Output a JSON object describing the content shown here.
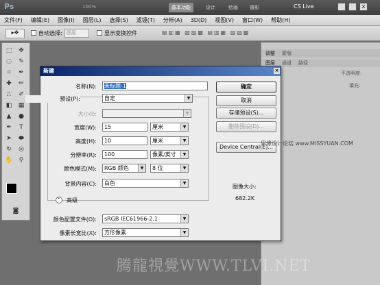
{
  "app": {
    "logo": "Ps",
    "zoom": "100%",
    "workspace": "基本功能",
    "ws_tabs": [
      "设计",
      "绘画",
      "摄影"
    ],
    "cslive": "CS Live"
  },
  "menu": [
    "文件(F)",
    "编辑(E)",
    "图像(I)",
    "图层(L)",
    "选择(S)",
    "滤镜(T)",
    "分析(A)",
    "3D(D)",
    "视图(V)",
    "窗口(W)",
    "帮助(H)"
  ],
  "options": {
    "auto_select": "自动选择:",
    "layer": "图层",
    "show_transform": "显示变换控件"
  },
  "panel": {
    "tabs1": [
      "调整",
      "蒙版"
    ],
    "tabs2": [
      "图层",
      "通道",
      "路径"
    ],
    "opacity": "不透明度:",
    "fill": "填充:"
  },
  "dialog": {
    "title": "新建",
    "name_label": "名称(N):",
    "name_value": "未标题-1",
    "preset_label": "预设(P):",
    "preset_value": "自定",
    "size_label": "大小(I):",
    "width_label": "宽度(W):",
    "width_value": "15",
    "width_unit": "厘米",
    "height_label": "高度(H):",
    "height_value": "10",
    "height_unit": "厘米",
    "res_label": "分辨率(R):",
    "res_value": "100",
    "res_unit": "像素/英寸",
    "mode_label": "颜色模式(M):",
    "mode_value": "RGB 颜色",
    "bits_value": "8 位",
    "bg_label": "背景内容(C):",
    "bg_value": "白色",
    "advanced": "高级",
    "profile_label": "颜色配置文件(O):",
    "profile_value": "sRGB IEC61966-2.1",
    "aspect_label": "像素长宽比(X):",
    "aspect_value": "方形像素",
    "ok": "确定",
    "cancel": "取消",
    "save_preset": "存储预设(S)...",
    "delete_preset": "删除预设(D)...",
    "device_central": "Device Central(E)...",
    "image_size_label": "图像大小:",
    "image_size_value": "682.2K"
  },
  "watermark": "腾龍視覺WWW.TLVI.NET",
  "watermark2": "思缘设计论坛 www.MISSYUAN.COM"
}
